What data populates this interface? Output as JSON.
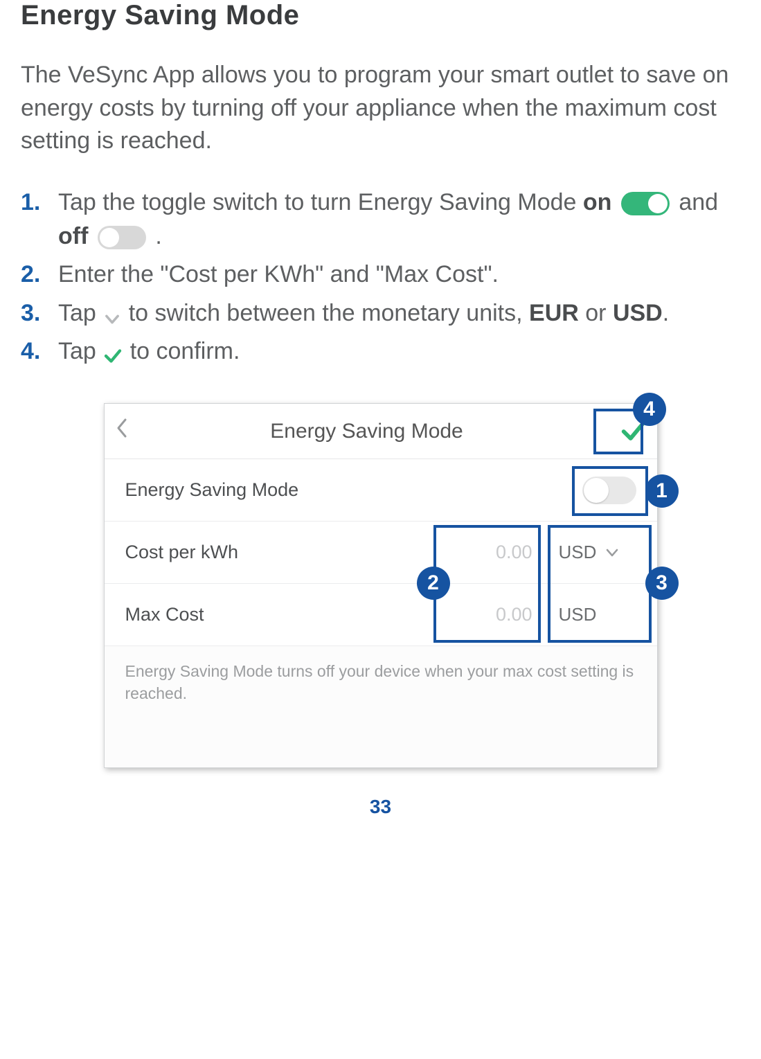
{
  "title": "Energy Saving Mode",
  "intro": "The VeSync App allows you to program your smart outlet to save on energy costs by turning off your appliance when the maximum cost setting is reached.",
  "steps": {
    "s1": {
      "num": "1.",
      "a": "Tap the toggle switch to turn Energy Saving Mode ",
      "on": "on",
      "mid": " and ",
      "off": "off",
      "end": " ."
    },
    "s2": {
      "num": "2.",
      "text": "Enter the \"Cost per KWh\" and \"Max Cost\"."
    },
    "s3": {
      "num": "3.",
      "a": "Tap ",
      "b": " to switch between the monetary units, ",
      "eur": "EUR",
      "or": " or ",
      "usd": "USD",
      "end": "."
    },
    "s4": {
      "num": "4.",
      "a": "Tap ",
      "b": " to confirm."
    }
  },
  "phone": {
    "header_title": "Energy Saving Mode",
    "row_mode_label": "Energy Saving Mode",
    "row_cost_label": "Cost per kWh",
    "row_cost_value": "0.00",
    "row_cost_unit": "USD",
    "row_max_label": "Max Cost",
    "row_max_value": "0.00",
    "row_max_unit": "USD",
    "help": "Energy Saving Mode turns off your device when your max cost setting is reached."
  },
  "callouts": {
    "c1": "1",
    "c2": "2",
    "c3": "3",
    "c4": "4"
  },
  "page_number": "33"
}
